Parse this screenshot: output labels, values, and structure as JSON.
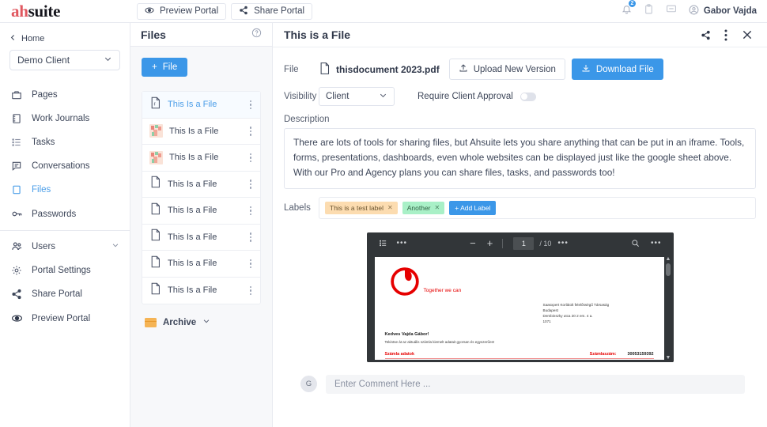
{
  "brand": {
    "part1": "ah",
    "part2": "suite",
    "accent": "#e0575f",
    "blue": "#3b97e8"
  },
  "topbar": {
    "preview_portal": "Preview Portal",
    "share_portal": "Share Portal",
    "notification_count": "2",
    "user_name": "Gabor Vajda"
  },
  "sidebar": {
    "home": "Home",
    "client_selected": "Demo Client",
    "items": [
      {
        "label": "Pages",
        "icon": "folder-icon",
        "active": false
      },
      {
        "label": "Work Journals",
        "icon": "journal-icon",
        "active": false
      },
      {
        "label": "Tasks",
        "icon": "list-icon",
        "active": false
      },
      {
        "label": "Conversations",
        "icon": "chat-icon",
        "active": false
      },
      {
        "label": "Files",
        "icon": "file-icon",
        "active": true
      },
      {
        "label": "Passwords",
        "icon": "key-icon",
        "active": false
      },
      {
        "label": "Users",
        "icon": "users-icon",
        "active": false
      },
      {
        "label": "Portal Settings",
        "icon": "gear-icon",
        "active": false
      },
      {
        "label": "Share Portal",
        "icon": "share-icon",
        "active": false
      },
      {
        "label": "Preview Portal",
        "icon": "eye-icon",
        "active": false
      }
    ]
  },
  "filepanel": {
    "title": "Files",
    "add_button": "+ File",
    "add_button_plus": "+",
    "add_button_text": "File",
    "archive_label": "Archive",
    "files": [
      {
        "name": "This Is a File",
        "type": "pdf",
        "selected": true
      },
      {
        "name": "This Is a File",
        "type": "image",
        "selected": false
      },
      {
        "name": "This Is a File",
        "type": "image",
        "selected": false
      },
      {
        "name": "This Is a File",
        "type": "pdf",
        "selected": false
      },
      {
        "name": "This Is a File",
        "type": "pdf",
        "selected": false
      },
      {
        "name": "This Is a File",
        "type": "pdf",
        "selected": false
      },
      {
        "name": "This Is a File",
        "type": "pdf",
        "selected": false
      },
      {
        "name": "This Is a File",
        "type": "pdf",
        "selected": false
      }
    ]
  },
  "detail": {
    "title": "This is a File",
    "file_label": "File",
    "file_name": "thisdocument 2023.pdf",
    "upload_button": "Upload New Version",
    "download_button": "Download File",
    "visibility_label": "Visibility",
    "visibility_value": "Client",
    "require_approval_label": "Require Client Approval",
    "require_approval_on": false,
    "description_label": "Description",
    "description_text": "There are lots of tools for sharing files, but Ahsuite lets you share anything that can be put in an iframe. Tools, forms, presentations, dashboards, even whole websites can be displayed just like the google sheet above. With our Pro and Agency plans you can share files, tasks, and passwords too!",
    "labels_label": "Labels",
    "labels": [
      {
        "text": "This is a test label",
        "color": "orange"
      },
      {
        "text": "Another",
        "color": "green"
      }
    ],
    "add_label_button": "+ Add Label"
  },
  "pdf_viewer": {
    "page_current": "1",
    "page_total": "/ 10",
    "zoom_out": "−",
    "zoom_in": "+",
    "dots": "•••",
    "document": {
      "tagline": "Together we can",
      "address_lines": [
        "Saasxpert Korlátolt felelősségű Társaság",
        "Budapest",
        "Dembinszky utca 20 2 em. 4 a.",
        "1071"
      ],
      "greeting": "Kedves  Vajda Gábor!",
      "subtitle": "Tekintse át az aktuális számla kiemelt adatait gyorsan és egyszerűen!",
      "footer_left": "Számla adatok",
      "footer_mid": "Számlaszám:",
      "footer_right": "30053159392"
    }
  },
  "comment": {
    "avatar_initial": "G",
    "placeholder": "Enter Comment Here ..."
  }
}
